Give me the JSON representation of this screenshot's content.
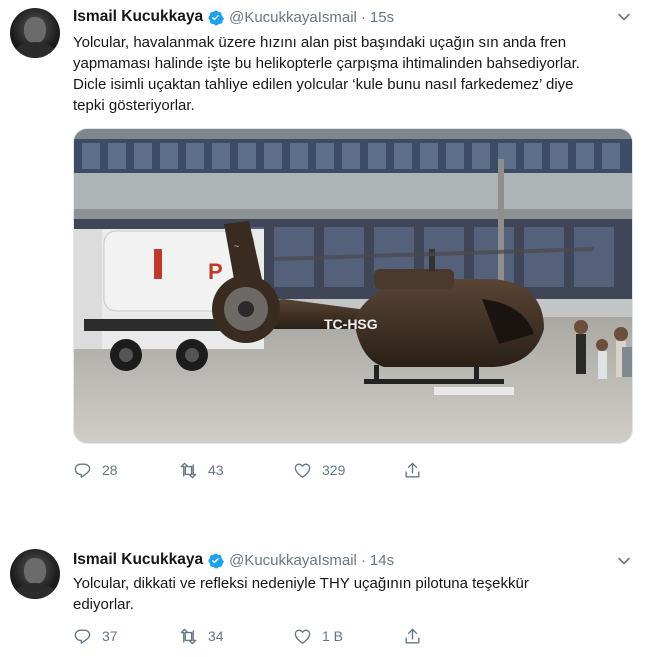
{
  "tweets": [
    {
      "author_name": "Ismail Kucukkaya",
      "handle": "@KucukkayaIsmail",
      "separator": "·",
      "time": "15s",
      "lines": [
        "Yolcular, havalanmak üzere hızını alan pist başındaki uçağın sın anda fren",
        "yapmaması halinde işte bu helikopterle çarpışma ihtimalinden bahsediyorlar.",
        "Dicle isimli uçaktan tahliye edilen yolcular ‘kule bunu nasıl farkedemez’ diye",
        "tepki gösteriyorlar."
      ],
      "media_text": {
        "registration": "TC-HSG",
        "building_sign": "P"
      },
      "replies": "28",
      "retweets": "43",
      "likes": "329"
    },
    {
      "author_name": "Ismail Kucukkaya",
      "handle": "@KucukkayaIsmail",
      "separator": "·",
      "time": "14s",
      "lines": [
        "Yolcular, dikkati ve refleksi nedeniyle THY uçağının pilotuna teşekkür",
        "ediyorlar."
      ],
      "replies": "37",
      "retweets": "34",
      "likes": "1 B"
    }
  ],
  "icons": {
    "verified": "verified-badge-icon",
    "caret": "chevron-down-icon",
    "reply": "reply-icon",
    "retweet": "retweet-icon",
    "like": "heart-icon",
    "share": "share-icon"
  },
  "colors": {
    "verified": "#1da1f2",
    "muted": "#657786",
    "text": "#14171a"
  }
}
